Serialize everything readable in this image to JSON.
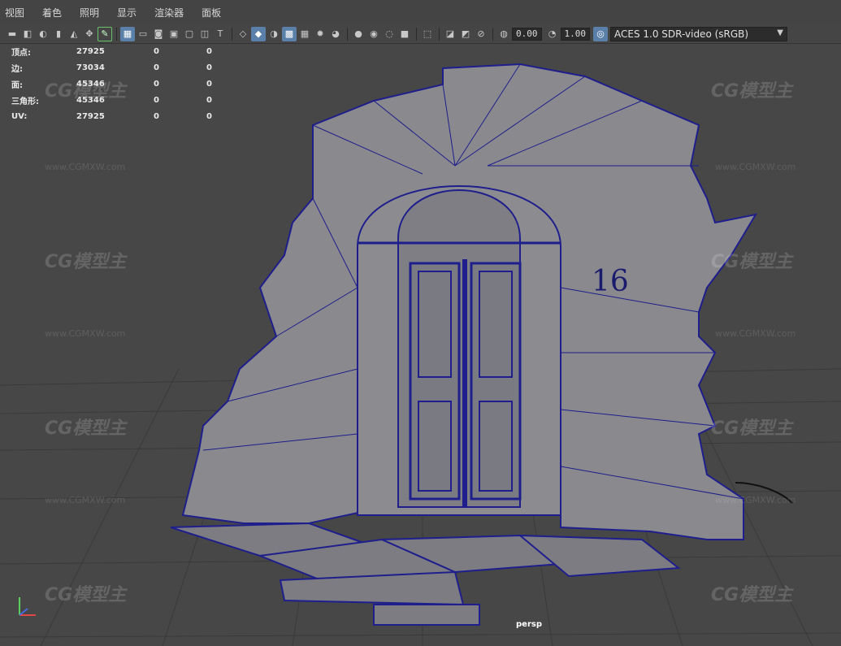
{
  "menu": [
    "视图",
    "着色",
    "照明",
    "显示",
    "渲染器",
    "面板"
  ],
  "toolbar": {
    "field_a": "0.00",
    "field_b": "1.00",
    "color_space": "ACES 1.0 SDR-video (sRGB)"
  },
  "hud": {
    "rows": [
      {
        "label": "顶点:",
        "value": "27925",
        "a": "0",
        "b": "0"
      },
      {
        "label": "边:",
        "value": "73034",
        "a": "0",
        "b": "0"
      },
      {
        "label": "面:",
        "value": "45346",
        "a": "0",
        "b": "0"
      },
      {
        "label": "三角形:",
        "value": "45346",
        "a": "0",
        "b": "0"
      },
      {
        "label": "UV:",
        "value": "27925",
        "a": "0",
        "b": "0"
      }
    ]
  },
  "viewport": {
    "camera": "persp",
    "house_number": "16"
  },
  "watermark": {
    "logo": "CG模型主",
    "url": "www.CGMXW.com"
  },
  "colors": {
    "wire": "#1e1e8c",
    "mesh": "#8a8a8e",
    "grid": "#3a3a3a"
  }
}
